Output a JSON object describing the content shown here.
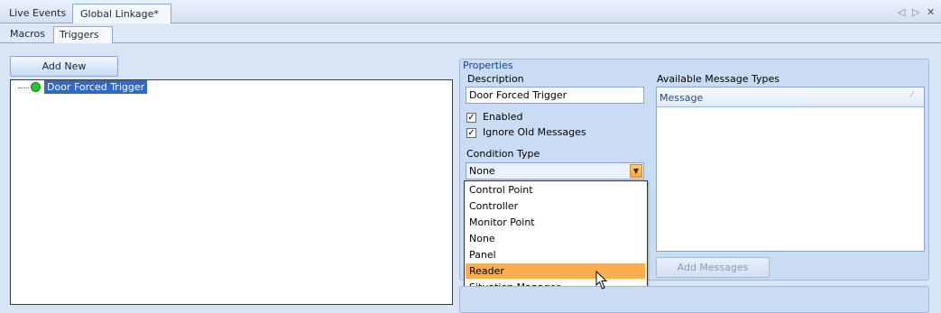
{
  "doc_tabs": [
    "Live Events",
    "Global Linkage*"
  ],
  "window_controls": {
    "prev": "◁",
    "next": "▷",
    "close": "✕"
  },
  "sub_tabs": [
    "Macros",
    "Triggers"
  ],
  "add_new_label": "Add New",
  "tree": {
    "nodes": [
      {
        "label": "Door Forced Trigger",
        "status_color": "#2bc62b"
      }
    ]
  },
  "properties": {
    "title": "Properties",
    "description_label": "Description",
    "description_value": "Door Forced Trigger",
    "enabled_label": "Enabled",
    "enabled_checked": true,
    "ignore_label": "Ignore Old Messages",
    "ignore_checked": true,
    "condition_label": "Condition Type",
    "condition_value": "None",
    "condition_options": [
      "Control Point",
      "Controller",
      "Monitor Point",
      "None",
      "Panel",
      "Reader",
      "Situation Manager"
    ],
    "highlighted_option": "Reader",
    "available_label": "Available Message Types",
    "grid_column": "Message",
    "add_messages_label": "Add Messages"
  },
  "check_mark": "✓",
  "sort_glyph": "⁄",
  "dropdown_glyph": "▼",
  "colors": {
    "accent_selection": "#316ac5",
    "dropdown_highlight": "#fbae50",
    "panel": "#c9dcf3"
  }
}
